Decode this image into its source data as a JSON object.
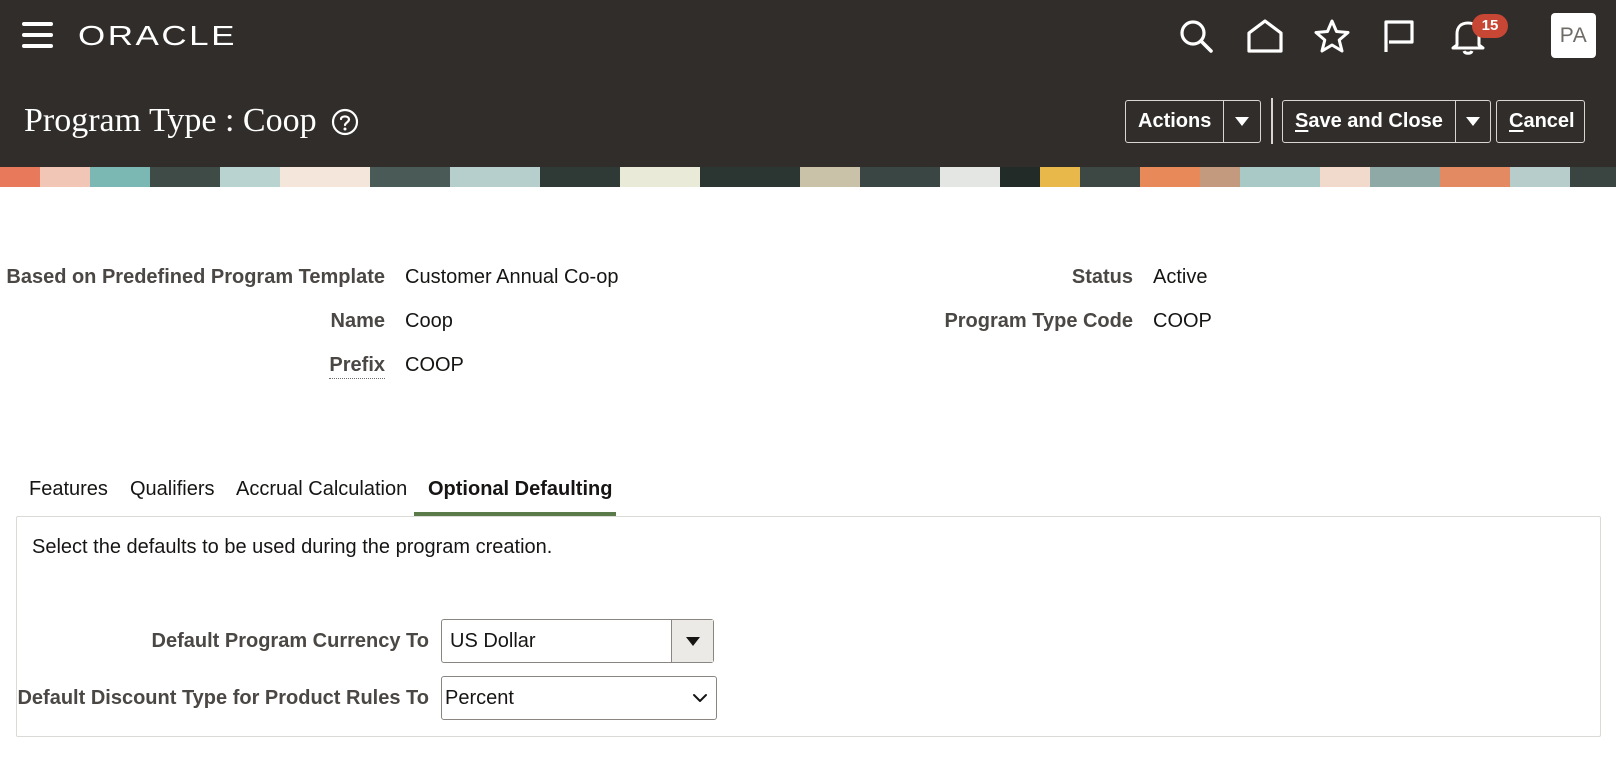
{
  "header": {
    "logo": "ORACLE",
    "notification_count": "15",
    "avatar_initials": "PA",
    "page_title": "Program Type : Coop",
    "actions": {
      "actions_label": "Actions",
      "save_close_label": [
        "S",
        "ave and Close"
      ],
      "cancel_label": [
        "C",
        "ancel"
      ]
    },
    "icons": [
      "hamburger-icon",
      "search-icon",
      "home-icon",
      "star-icon",
      "flag-icon",
      "bell-icon",
      "help-icon"
    ]
  },
  "details": {
    "template_label": "Based on Predefined Program Template",
    "template_value": "Customer Annual Co-op",
    "name_label": "Name",
    "name_value": "Coop",
    "prefix_label": "Prefix",
    "prefix_value": "COOP",
    "status_label": "Status",
    "status_value": "Active",
    "code_label": "Program Type Code",
    "code_value": "COOP"
  },
  "tabs": [
    {
      "label": "Features",
      "active": false
    },
    {
      "label": "Qualifiers",
      "active": false
    },
    {
      "label": "Accrual Calculation",
      "active": false
    },
    {
      "label": "Optional Defaulting",
      "active": true
    }
  ],
  "optional_defaulting": {
    "intro": "Select the defaults to be used during the program creation.",
    "currency_label": "Default Program Currency To",
    "currency_value": "US Dollar",
    "discount_label": "Default Discount Type for Product Rules To",
    "discount_value": "Percent"
  },
  "colors": {
    "header_bg": "#312d2a",
    "active_tab_underline": "#5a7a4a",
    "badge": "#c74634"
  }
}
